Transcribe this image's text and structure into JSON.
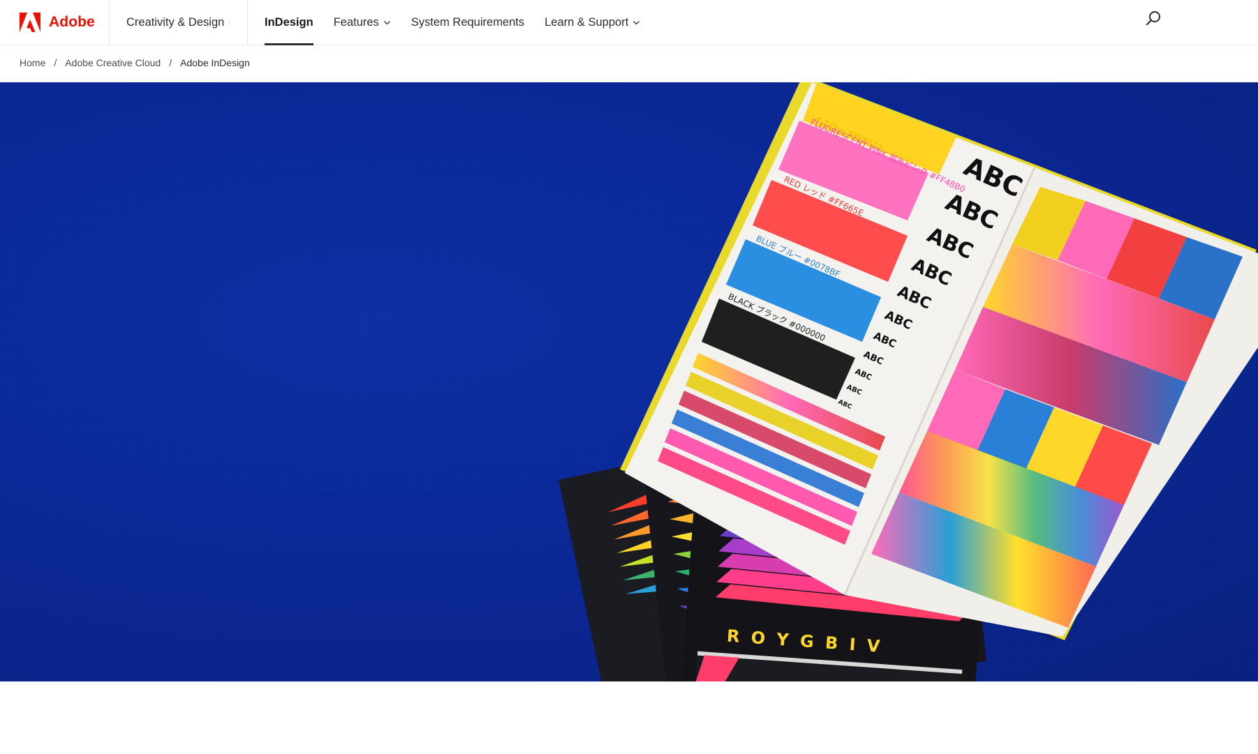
{
  "brand": {
    "name": "Adobe",
    "color": "#eb1000"
  },
  "nav": {
    "creativity": "Creativity & Design",
    "product": "InDesign",
    "features": "Features",
    "system_requirements": "System Requirements",
    "learn_support": "Learn & Support",
    "search_icon": "search-icon"
  },
  "breadcrumb": {
    "home": "Home",
    "separator": "/",
    "creative_cloud": "Adobe Creative Cloud",
    "current": "Adobe InDesign"
  },
  "hero": {
    "background_color": "#0a2796",
    "swatch_labels": {
      "yellow": "イエロー #FFB511",
      "pink": "FLUORESCENT PINK 蛍光ピンク #FF48B0",
      "red": "RED レッド #FF665E",
      "blue": "BLUE ブルー #0078BF",
      "black": "BLACK ブラック #000000"
    },
    "specimen_text": "ABC",
    "cover_text": "R O Y G B I V"
  }
}
